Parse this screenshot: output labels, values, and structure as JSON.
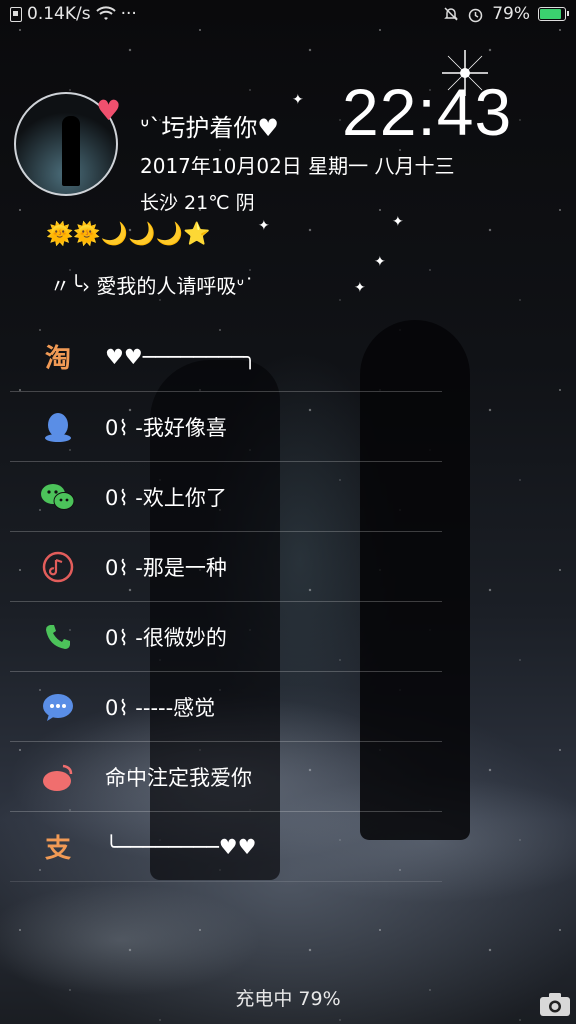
{
  "status_bar": {
    "network_speed": "0.14K/s",
    "more": "···",
    "battery_percent": "79%",
    "battery_level": 0.79
  },
  "widget": {
    "name": "ᐡ`圬护着你♥",
    "clock": "22:43",
    "date": "2017年10月02日 星期一 八月十三",
    "weather": "长沙 21℃ 阴",
    "emoji_row": "🌞🌞🌙🌙🌙⭐",
    "motto": "〃╰› 愛我的人请呼吸ᐡ˙"
  },
  "apps": [
    {
      "icon": "taobao-icon",
      "glyph": "淘",
      "color": "#f19a55",
      "label": "♥♥────────╮"
    },
    {
      "icon": "qq-icon",
      "color": "#5a8ee6",
      "label": "0⌇  -我好像喜"
    },
    {
      "icon": "wechat-icon",
      "color": "#4cc35a",
      "label": "0⌇  -欢上你了"
    },
    {
      "icon": "music-icon",
      "color": "#e35d5b",
      "label": "0⌇  -那是一种"
    },
    {
      "icon": "phone-icon",
      "color": "#4cc35a",
      "label": "0⌇  -很微妙的"
    },
    {
      "icon": "messages-icon",
      "color": "#5a8ee6",
      "label": "0⌇  -----感觉"
    },
    {
      "icon": "weibo-icon",
      "color": "#f06e6e",
      "label": "命中注定我爱你"
    },
    {
      "icon": "zhi-icon",
      "glyph": "支",
      "color": "#f19a55",
      "label": "╰────────♥♥"
    }
  ],
  "charging_text": "充电中 79%"
}
